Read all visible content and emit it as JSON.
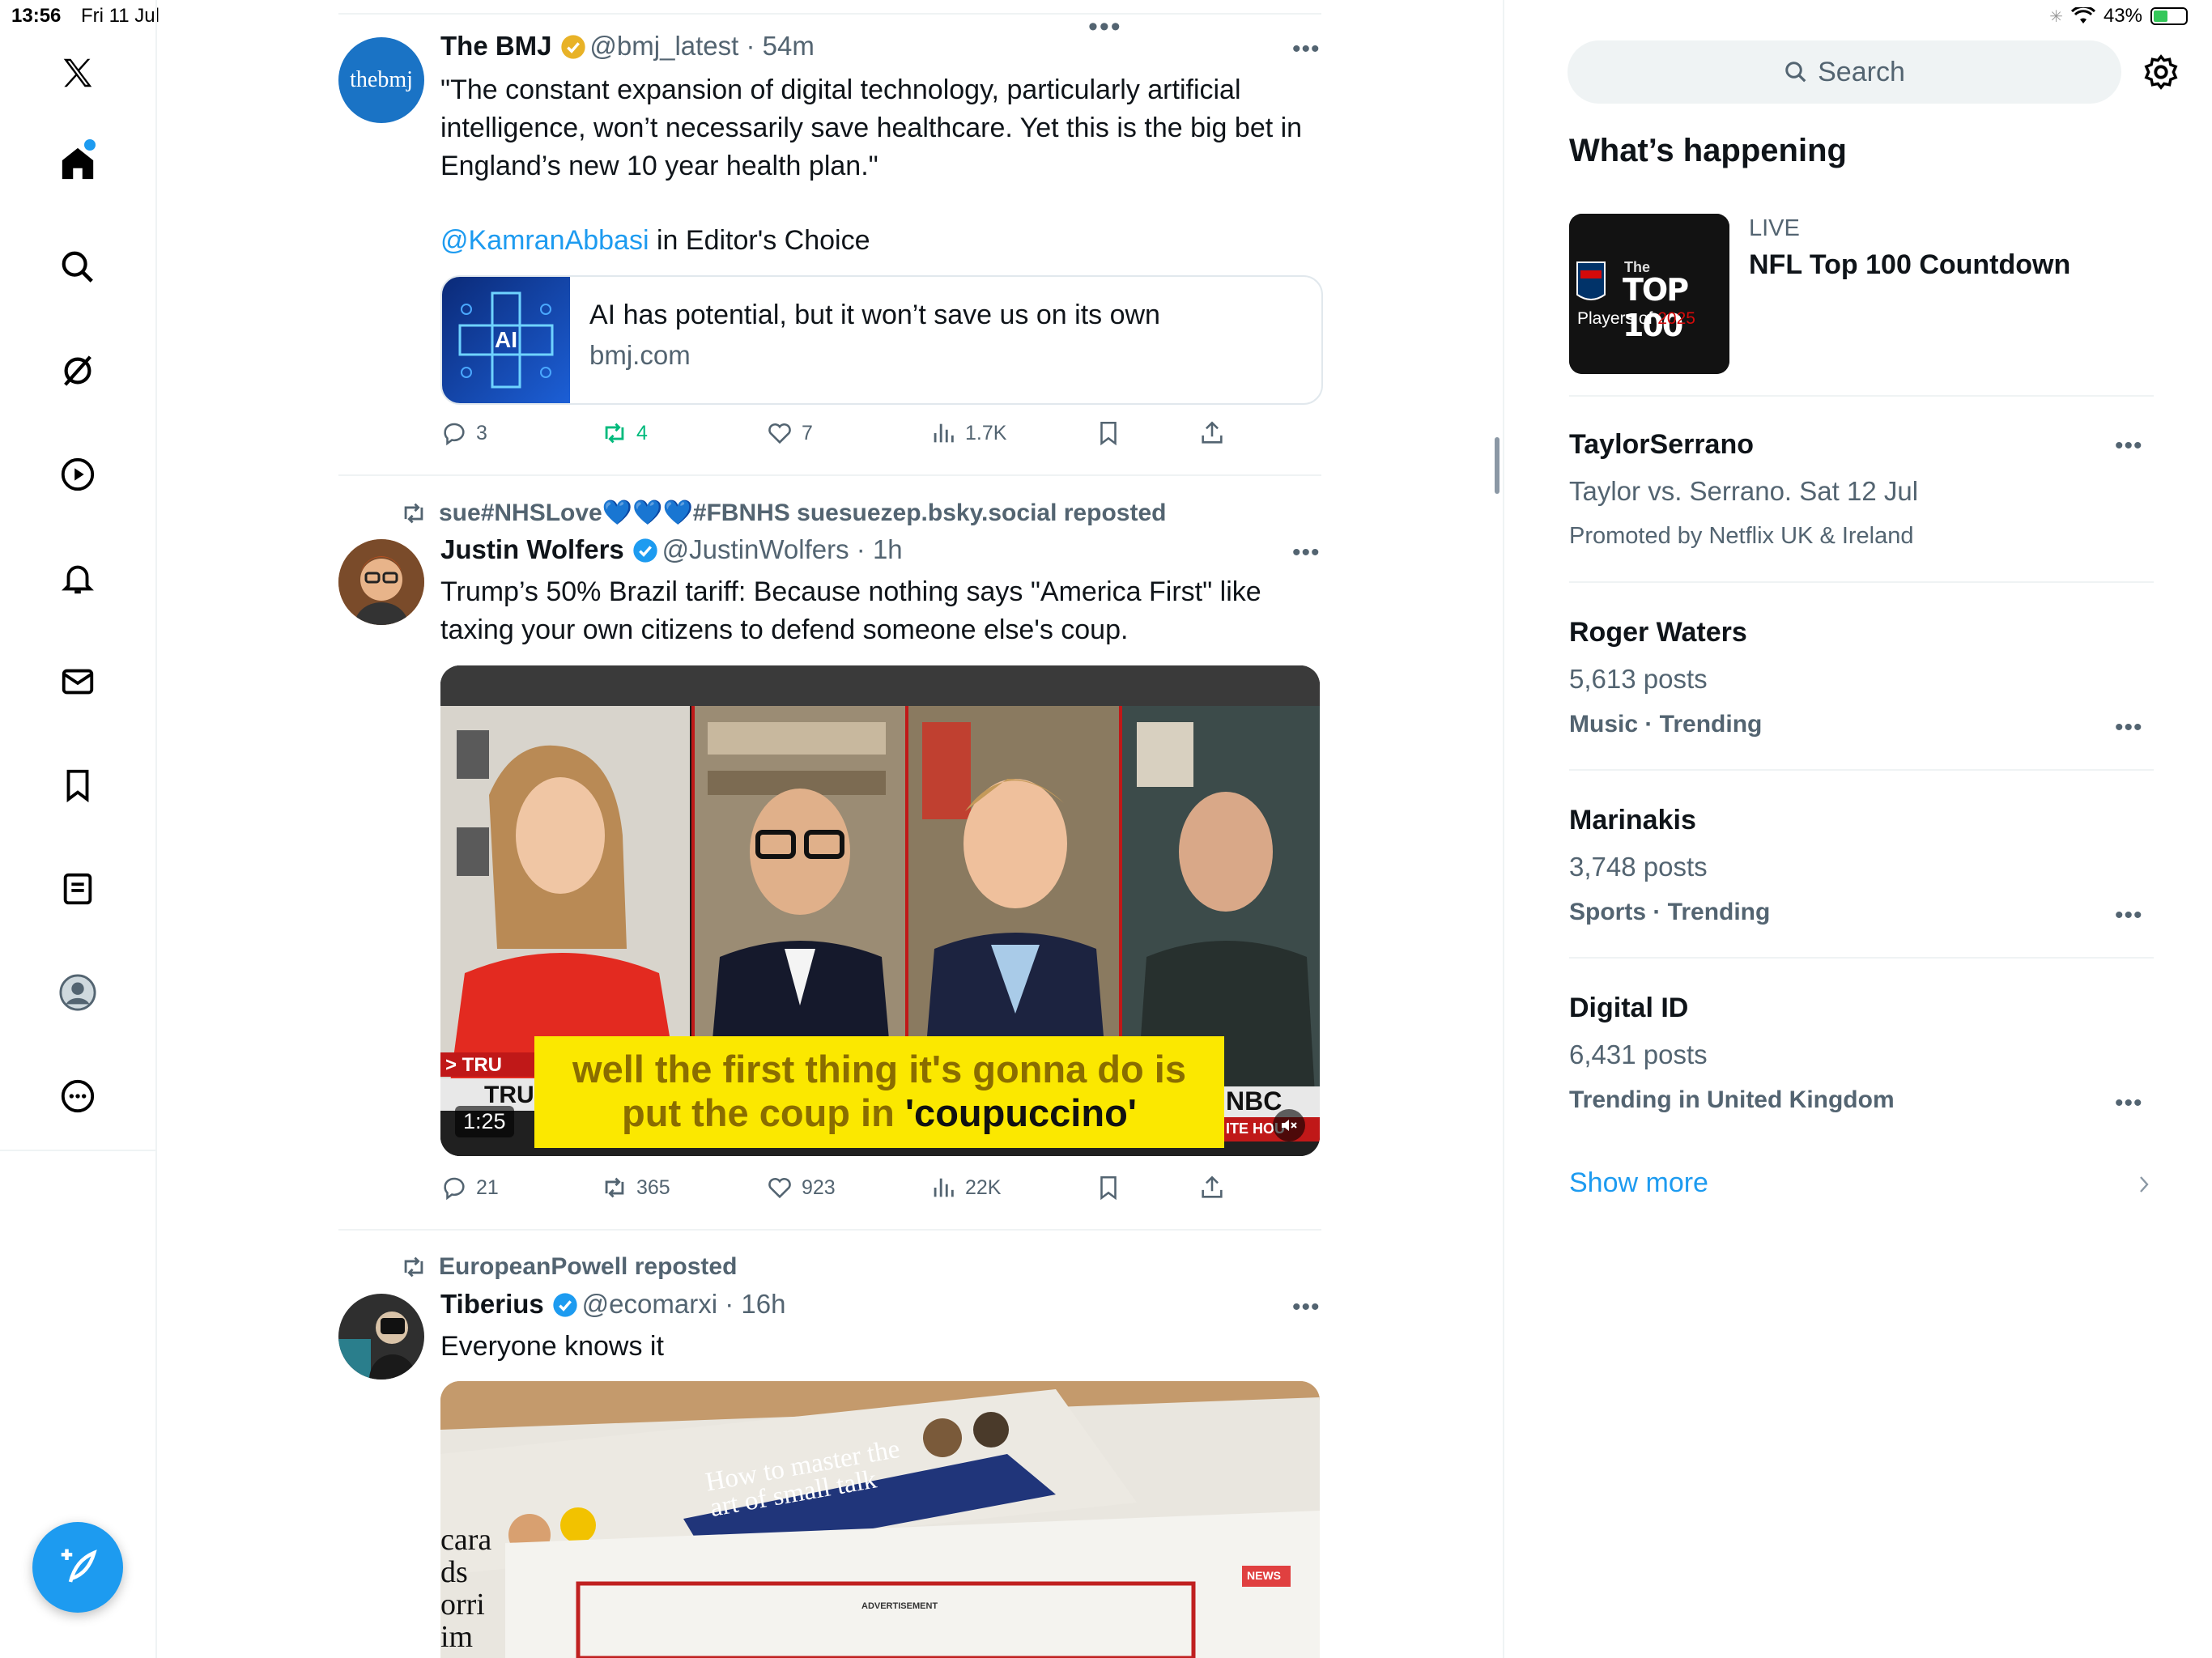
{
  "status_bar": {
    "time": "13:56",
    "date": "Fri 11 Jul",
    "battery": "43%"
  },
  "nav": {
    "items": [
      "x-logo",
      "home",
      "explore",
      "grok",
      "video",
      "notifications",
      "messages",
      "bookmarks",
      "lists",
      "profile",
      "more"
    ]
  },
  "feed": {
    "drag_handle": "•••",
    "tweets": [
      {
        "avatar_text": "thebmj",
        "name": "The BMJ",
        "handle": "@bmj_latest",
        "time": "54m",
        "text": "\"The constant expansion of digital technology, particularly artificial intelligence, won’t necessarily save healthcare. Yet this is the big bet in England’s new 10 year health plan.\"",
        "mention": "@KamranAbbasi",
        "mention_suffix": " in Editor's Choice",
        "card": {
          "image_label": "AI",
          "title": "AI has potential, but it won’t save us on its own",
          "domain": "bmj.com"
        },
        "stats": {
          "replies": "3",
          "reposts": "4",
          "likes": "7",
          "views": "1.7K"
        }
      },
      {
        "repost_by": "sue#NHSLove💙💙💙#FBNHS suesuezep.bsky.social reposted",
        "name": "Justin Wolfers",
        "handle": "@JustinWolfers",
        "time": "1h",
        "text": "Trump’s 50% Brazil tariff: Because nothing says \"America First\" like taxing your own citizens to defend someone else's coup.",
        "video": {
          "caption_line1": "well the first thing it's gonna do is",
          "caption_line2_a": "put the coup in ",
          "caption_line2_b": "'coupuccino'",
          "duration": "1:25",
          "chyron_left_1": "> TRU",
          "chyron_left_2": "TRUM",
          "chyron_right_1": "NBC",
          "chyron_right_2": "ITE HOU"
        },
        "stats": {
          "replies": "21",
          "reposts": "365",
          "likes": "923",
          "views": "22K"
        }
      },
      {
        "repost_by": "EuropeanPowell reposted",
        "name": "Tiberius",
        "handle": "@ecomarxi",
        "time": "16h",
        "text": "Everyone knows it",
        "image": {
          "headline_1": "How to master the",
          "headline_2": "art of small talk",
          "left_fragments": [
            "cara",
            "ds",
            "orri",
            "im"
          ],
          "tag": "NEWS",
          "ad_label": "ADVERTISEMENT"
        }
      }
    ]
  },
  "sidebar": {
    "search_placeholder": "Search",
    "title": "What’s happening",
    "live": {
      "badge": "LIVE",
      "title": "NFL Top 100 Countdown",
      "thumb_line1": "The",
      "thumb_line2": "TOP 100",
      "thumb_line3a": "Players of ",
      "thumb_line3b": "2025"
    },
    "trends": [
      {
        "title": "TaylorSerrano",
        "subtitle": "Taylor vs. Serrano. Sat 12 Jul",
        "meta": "Promoted by Netflix UK & Ireland"
      },
      {
        "title": "Roger Waters",
        "subtitle": "5,613 posts",
        "meta": "Music · Trending"
      },
      {
        "title": "Marinakis",
        "subtitle": "3,748 posts",
        "meta": "Sports · Trending"
      },
      {
        "title": "Digital ID",
        "subtitle": "6,431 posts",
        "meta": "Trending in United Kingdom"
      }
    ],
    "show_more": "Show more"
  },
  "colors": {
    "accent": "#1d9bf0",
    "repost_green": "#00ba7c",
    "text": "#0f1419",
    "muted": "#536471"
  }
}
